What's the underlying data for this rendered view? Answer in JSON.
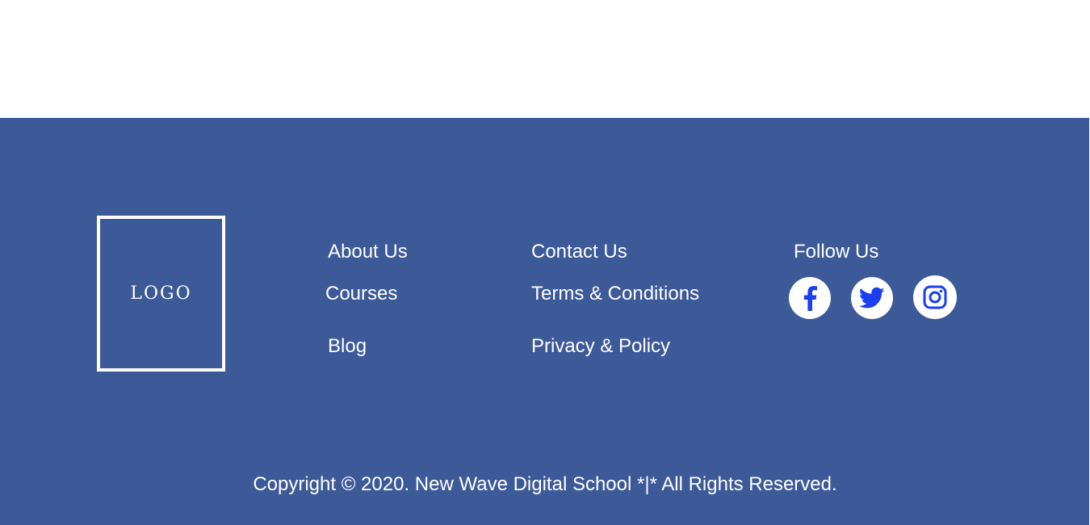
{
  "logo": {
    "text": "LOGO"
  },
  "links_col1": [
    {
      "label": "About Us"
    },
    {
      "label": "Courses"
    },
    {
      "label": "Blog"
    }
  ],
  "links_col2": [
    {
      "label": "Contact Us"
    },
    {
      "label": "Terms & Conditions"
    },
    {
      "label": "Privacy & Policy"
    }
  ],
  "follow": {
    "heading": "Follow Us",
    "icons": [
      "facebook-icon",
      "twitter-icon",
      "instagram-icon"
    ]
  },
  "copyright": "Copyright ©  2020. New Wave Digital School *|* All Rights Reserved.",
  "colors": {
    "footer_background": "#3c5998",
    "text": "#ffffff",
    "icon_glyph": "#1a3ef0"
  }
}
